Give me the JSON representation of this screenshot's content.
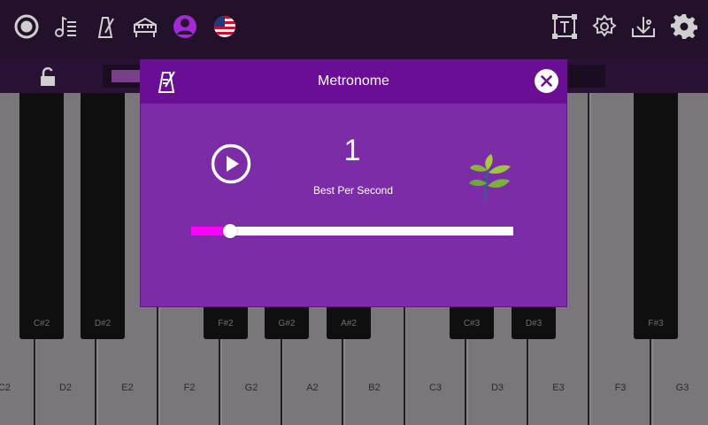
{
  "toolbar": {
    "left_icons": [
      "record-icon",
      "song-list-icon",
      "metronome-icon",
      "piano-icon",
      "profile-icon",
      "us-flag-icon"
    ],
    "right_icons": [
      "text-frame-icon",
      "settings-badge-icon",
      "download-song-icon",
      "gear-icon"
    ]
  },
  "strip": {
    "lock_icon": "unlock-icon"
  },
  "piano": {
    "white_keys": [
      "C2",
      "D2",
      "E2",
      "F2",
      "G2",
      "A2",
      "B2",
      "C3",
      "D3",
      "E3",
      "F3",
      "G3"
    ],
    "black_keys": [
      "C#2",
      "D#2",
      "F#2",
      "G#2",
      "A#2",
      "C#3",
      "D#3",
      "F#3"
    ]
  },
  "dialog": {
    "title": "Metronome",
    "value": "1",
    "label": "Best Per Second",
    "slider_level": 0.12,
    "colors": {
      "header": "#6a0e96",
      "body": "#7d2ca7",
      "fill": "#ff00ff"
    }
  }
}
